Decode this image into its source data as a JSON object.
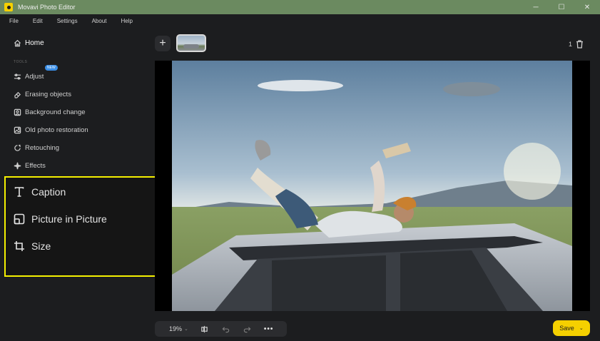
{
  "titlebar": {
    "title": "Movavi Photo Editor",
    "minimize": "─",
    "maximize": "☐",
    "close": "✕"
  },
  "menu": [
    "File",
    "Edit",
    "Settings",
    "About",
    "Help"
  ],
  "sidebar": {
    "home": "Home",
    "tools_label": "TOOLS",
    "badge": "NEW",
    "items": [
      "Adjust",
      "Erasing objects",
      "Background change",
      "Old photo restoration",
      "Retouching",
      "Effects"
    ]
  },
  "highlight_panel": {
    "items": [
      "Caption",
      "Picture in Picture",
      "Size"
    ],
    "border_color": "#f5f000"
  },
  "toolbar": {
    "add": "+",
    "photo_count": "1"
  },
  "bottom": {
    "zoom": "19%",
    "zoom_caret": "⌄",
    "more": "•••"
  },
  "save": {
    "label": "Save",
    "caret": "⌄"
  },
  "colors": {
    "accent": "#f5d000",
    "titlebar": "#6b8a60",
    "badge": "#3a8ee6"
  }
}
